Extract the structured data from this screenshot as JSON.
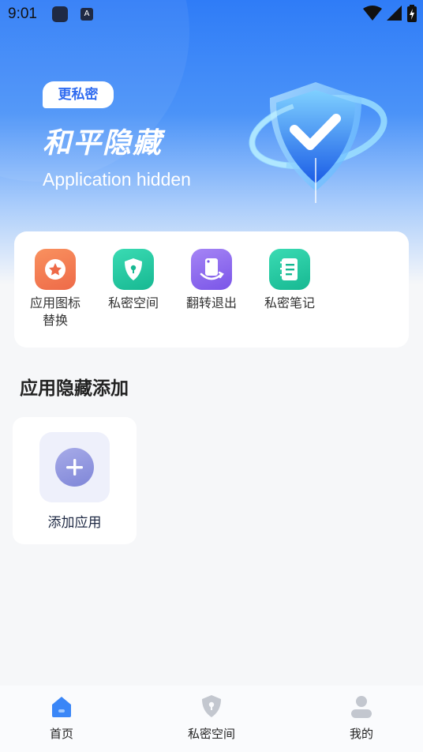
{
  "status_bar": {
    "time": "9:01",
    "app_letter": "A"
  },
  "hero": {
    "badge": "更私密",
    "title": "和平隐藏",
    "subtitle": "Application hidden"
  },
  "tools": [
    {
      "label": "应用图标替换",
      "icon": "star-icon",
      "color": "#f0764c"
    },
    {
      "label": "私密空间",
      "icon": "lock-shield-icon",
      "color": "#22c8a0"
    },
    {
      "label": "翻转退出",
      "icon": "flip-phone-icon",
      "color": "#8d6cf0"
    },
    {
      "label": "私密笔记",
      "icon": "notebook-icon",
      "color": "#22c8a0"
    }
  ],
  "section": {
    "title": "应用隐藏添加"
  },
  "add_app": {
    "label": "添加应用"
  },
  "tabbar": {
    "home": "首页",
    "private_space": "私密空间",
    "mine": "我的"
  },
  "colors": {
    "accent": "#3a86f7",
    "inactive": "#c3c7cf"
  }
}
